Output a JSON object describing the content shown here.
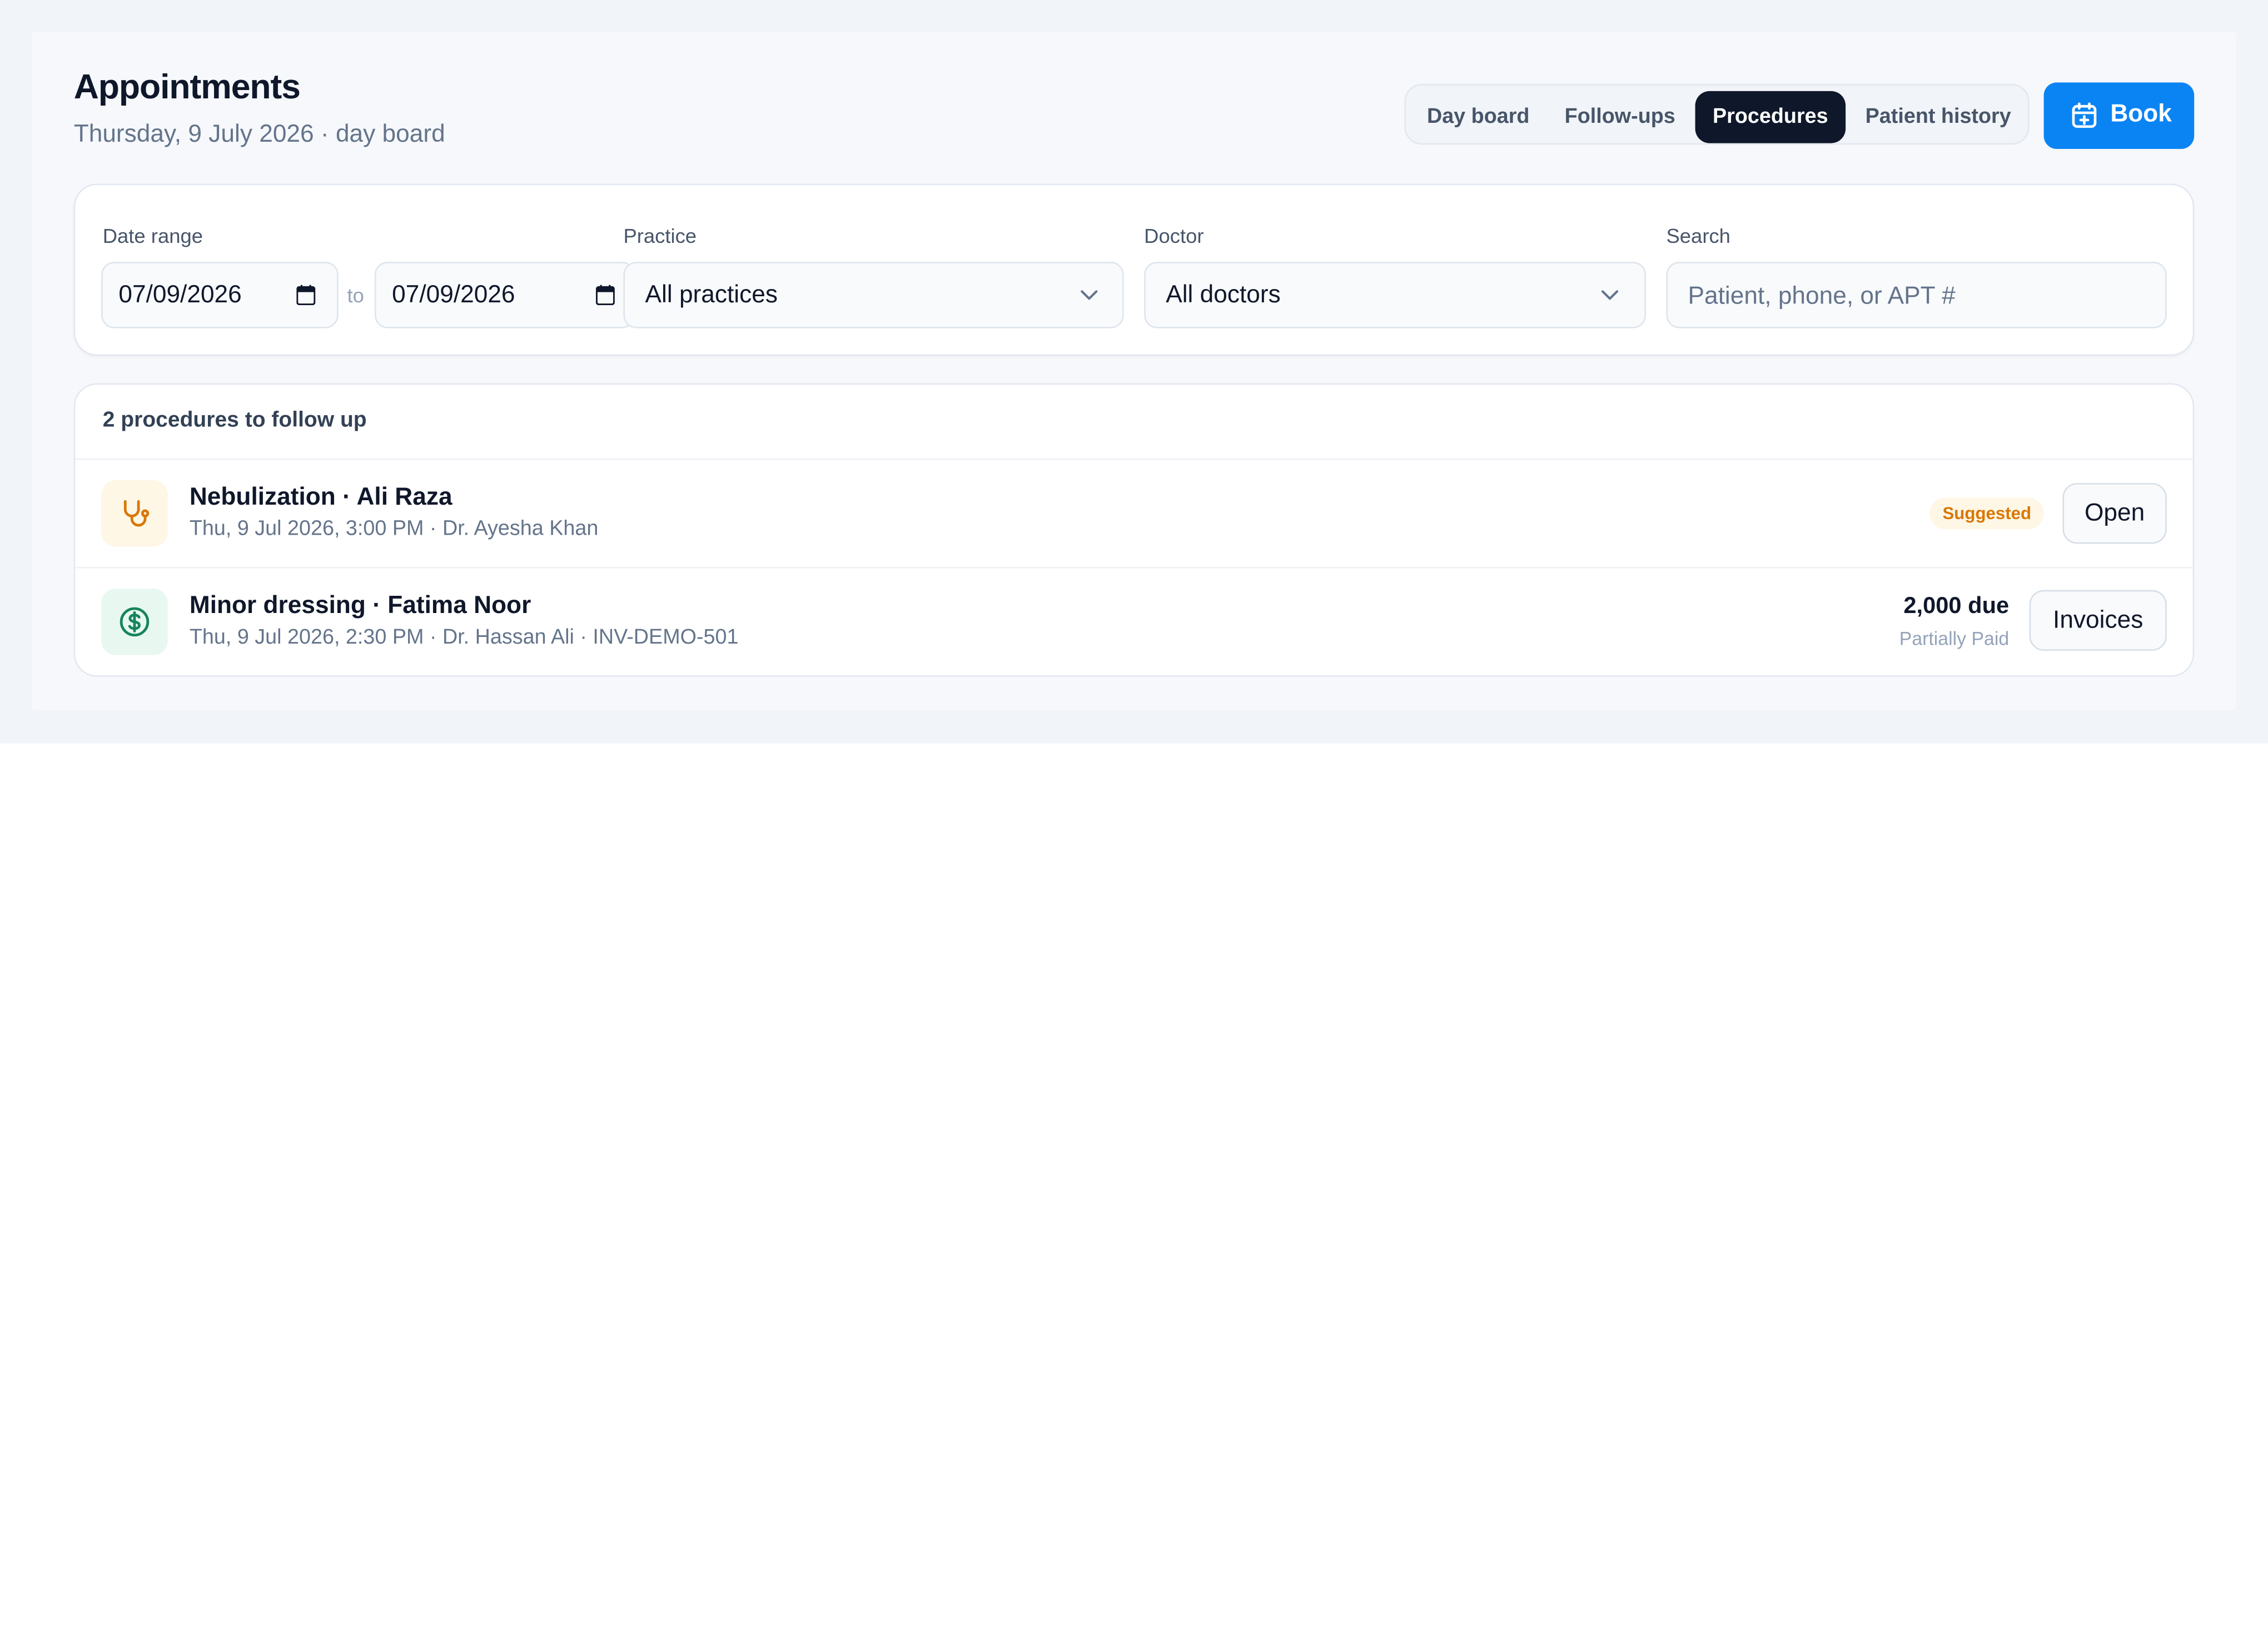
{
  "page": {
    "title": "Appointments",
    "subtitle": "Thursday, 9 July 2026 · day board"
  },
  "tabs": [
    {
      "label": "Day board",
      "active": false
    },
    {
      "label": "Follow-ups",
      "active": false
    },
    {
      "label": "Procedures",
      "active": true
    },
    {
      "label": "Patient history",
      "active": false
    }
  ],
  "book_button": {
    "label": "Book",
    "icon": "calendar-plus-icon"
  },
  "filters": {
    "date_range": {
      "label": "Date range",
      "from": "07/09/2026",
      "to_word": "to",
      "to": "07/09/2026"
    },
    "practice": {
      "label": "Practice",
      "value": "All practices"
    },
    "doctor": {
      "label": "Doctor",
      "value": "All doctors"
    },
    "search": {
      "label": "Search",
      "placeholder": "Patient, phone, or APT #",
      "value": ""
    }
  },
  "list": {
    "heading": "2 procedures to follow up",
    "items": [
      {
        "title": "Nebulization · Ali Raza",
        "meta": "Thu, 9 Jul 2026, 3:00 PM · Dr. Ayesha Khan",
        "icon": "stethoscope-icon",
        "badge": "Suggested",
        "action": "Open"
      },
      {
        "title": "Minor dressing · Fatima Noor",
        "meta": "Thu, 9 Jul 2026, 2:30 PM · Dr. Hassan Ali · INV-DEMO-501",
        "icon": "dollar-circle-icon",
        "amount": "2,000 due",
        "status": "Partially Paid",
        "action": "Invoices"
      }
    ]
  },
  "colors": {
    "accent": "#0b84f3",
    "active_tab": "#0f172a",
    "badge_text": "#d97706",
    "badge_bg": "#fff7e6",
    "money_icon": "#16855b"
  }
}
